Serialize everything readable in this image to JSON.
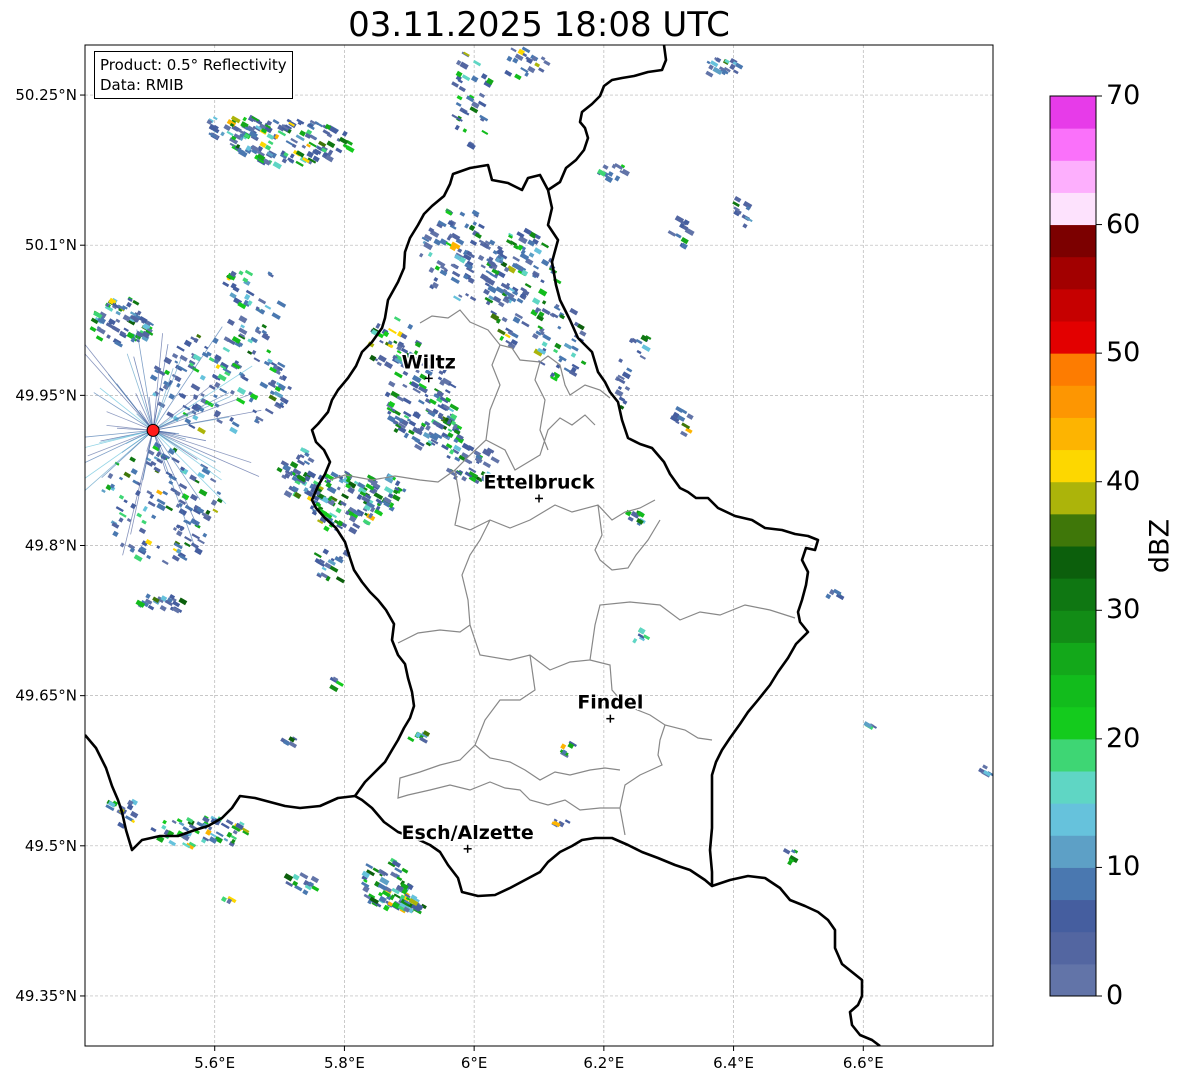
{
  "title": "03.11.2025 18:08 UTC",
  "info": {
    "product": "Product: 0.5° Reflectivity",
    "source": "Data: RMIB"
  },
  "map": {
    "lon_range": [
      5.4,
      6.8
    ],
    "lat_range": [
      49.3,
      50.3
    ],
    "lon_ticks": [
      {
        "value": 5.6,
        "label": "5.6°E"
      },
      {
        "value": 5.8,
        "label": "5.8°E"
      },
      {
        "value": 6.0,
        "label": "6°E"
      },
      {
        "value": 6.2,
        "label": "6.2°E"
      },
      {
        "value": 6.4,
        "label": "6.4°E"
      },
      {
        "value": 6.6,
        "label": "6.6°E"
      }
    ],
    "lat_ticks": [
      {
        "value": 49.35,
        "label": "49.35°N"
      },
      {
        "value": 49.5,
        "label": "49.5°N"
      },
      {
        "value": 49.65,
        "label": "49.65°N"
      },
      {
        "value": 49.8,
        "label": "49.8°N"
      },
      {
        "value": 49.95,
        "label": "49.95°N"
      },
      {
        "value": 50.1,
        "label": "50.1°N"
      },
      {
        "value": 50.25,
        "label": "50.25°N"
      }
    ],
    "grid": true,
    "radar_site": {
      "lon": 5.505,
      "lat": 49.915
    },
    "cities": [
      {
        "name": "Wiltz",
        "lon": 5.93,
        "lat": 49.967
      },
      {
        "name": "Ettelbruck",
        "lon": 6.1,
        "lat": 49.847
      },
      {
        "name": "Findel",
        "lon": 6.21,
        "lat": 49.627
      },
      {
        "name": "Esch/Alzette",
        "lon": 5.99,
        "lat": 49.497
      }
    ],
    "colors": {
      "border": "#000000",
      "district": "#888888",
      "grid": "#b5b5b5"
    }
  },
  "colorbar": {
    "label": "dBZ",
    "ticks": [
      "0",
      "10",
      "20",
      "30",
      "40",
      "50",
      "60",
      "70"
    ],
    "min": 0,
    "max": 70,
    "colors": [
      "#6274a8",
      "#5366a1",
      "#455e9f",
      "#4a78b0",
      "#5da0c6",
      "#66c2dc",
      "#5fd6c4",
      "#3ed674",
      "#14cb1d",
      "#12bc1c",
      "#13a81a",
      "#128c16",
      "#0f7712",
      "#0c5f0c",
      "#3f7709",
      "#acb40a",
      "#fdd700",
      "#fdb401",
      "#fd9602",
      "#fd7c01",
      "#e30000",
      "#c60000",
      "#a20000",
      "#7c0000",
      "#fde2fd",
      "#fdaffd",
      "#fa71fa",
      "#e73be9"
    ]
  }
}
